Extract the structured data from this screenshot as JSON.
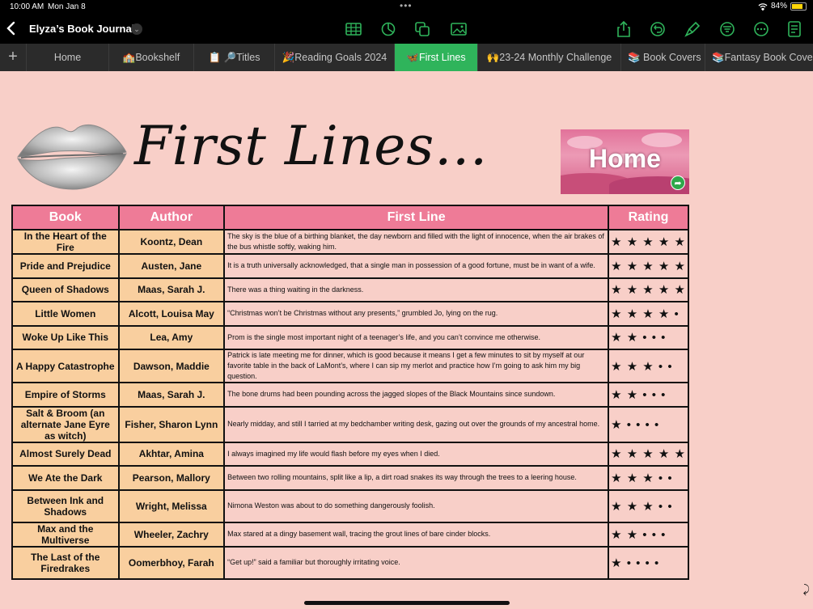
{
  "status": {
    "time": "10:00 AM",
    "date": "Mon Jan 8",
    "battery": "84%",
    "battery_level": 0.84
  },
  "toolbar": {
    "back_icon": "chevron-left-icon",
    "title": "Elyza’s Book Journal",
    "icons": [
      "table-icon",
      "chart-icon",
      "shapes-icon",
      "media-icon",
      "share-icon",
      "undo-icon",
      "format-brush-icon",
      "organize-icon",
      "more-icon",
      "document-icon"
    ]
  },
  "tabs": [
    {
      "label": "Home"
    },
    {
      "label": "🏫Bookshelf"
    },
    {
      "label": "📋 🔎Titles"
    },
    {
      "label": "🎉Reading Goals 2024"
    },
    {
      "label": "🦋First Lines",
      "active": true
    },
    {
      "label": "🙌23-24 Monthly Challenge"
    },
    {
      "label": "📚 Book Covers"
    },
    {
      "label": "📚Fantasy Book Covers"
    }
  ],
  "header": {
    "title": "First Lines...",
    "home_button": "Home"
  },
  "table": {
    "columns": [
      "Book",
      "Author",
      "First Line",
      "Rating"
    ],
    "rows": [
      {
        "book": "In the Heart of the Fire",
        "author": "Koontz, Dean",
        "line": "The sky is the blue of a birthing blanket, the day newborn and filled with the light of innocence, when the air brakes of the bus whistle softly, waking him.",
        "rating": "★ ★ ★ ★ ★",
        "stars": 5
      },
      {
        "book": "Pride and Prejudice",
        "author": "Austen, Jane",
        "line": "It is a truth universally acknowledged, that a single man in possession of a good fortune, must be in want of a wife.",
        "rating": "★ ★ ★ ★ ★",
        "stars": 5
      },
      {
        "book": "Queen of Shadows",
        "author": "Maas, Sarah J.",
        "line": "There was a thing waiting in the darkness.",
        "rating": "★ ★ ★ ★ ★",
        "stars": 5
      },
      {
        "book": "Little Women",
        "author": "Alcott, Louisa May",
        "line": "“Christmas won’t be Christmas without any presents,” grumbled Jo, lying on the rug.",
        "rating": "★ ★ ★ ★ •",
        "stars": 4
      },
      {
        "book": "Woke Up Like This",
        "author": "Lea, Amy",
        "line": "Prom is the single most important night of a teenager’s life, and you can’t convince me otherwise.",
        "rating": "★ ★ • • •",
        "stars": 2
      },
      {
        "book": "A Happy Catastrophe",
        "author": "Dawson, Maddie",
        "line": "Patrick is late meeting me for dinner, which is good because it means I get a few minutes to sit by myself at our favorite table in the back of LaMont’s, where I can sip my merlot and practice how I’m going to ask him my big question.",
        "rating": "★ ★ ★ • •",
        "stars": 3
      },
      {
        "book": "Empire of Storms",
        "author": "Maas, Sarah J.",
        "line": "The bone drums had been pounding across the jagged slopes of the Black Mountains since sundown.",
        "rating": "★ ★ • • •",
        "stars": 2
      },
      {
        "book": "Salt & Broom (an alternate Jane Eyre as witch)",
        "author": "Fisher, Sharon Lynn",
        "line": "Nearly midday, and still I tarried at my bedchamber writing desk, gazing out over the grounds of my ancestral home.",
        "rating": "★ • • • •",
        "stars": 1,
        "small": true
      },
      {
        "book": "Almost Surely Dead",
        "author": "Akhtar, Amina",
        "line": "I always imagined my life would flash before my eyes when I died.",
        "rating": "★ ★ ★ ★ ★",
        "stars": 5
      },
      {
        "book": "We Ate the Dark",
        "author": "Pearson, Mallory",
        "line": "Between two rolling mountains, split like a lip, a dirt road snakes its way through the trees to a leering house.",
        "rating": "★ ★ ★ • •",
        "stars": 3
      },
      {
        "book": "Between Ink and Shadows",
        "author": "Wright, Melissa",
        "line": "Nimona Weston was about to do something dangerously foolish.",
        "rating": "★ ★ ★ • •",
        "stars": 3
      },
      {
        "book": "Max and the Multiverse",
        "author": "Wheeler, Zachry",
        "line": "Max stared at a dingy basement wall, tracing the grout lines of bare cinder blocks.",
        "rating": "★ ★ • • •",
        "stars": 2
      },
      {
        "book": "The Last of the Firedrakes",
        "author": "Oomerbhoy, Farah",
        "line": "“Get up!” said a familiar but thoroughly irritating voice.",
        "rating": "★ • • • •",
        "stars": 1
      }
    ]
  },
  "colors": {
    "header_pink": "#ee7b97",
    "cell_peach": "#f9cf9f",
    "page_bg": "#f8cfc8",
    "active_tab": "#2fb45b"
  }
}
